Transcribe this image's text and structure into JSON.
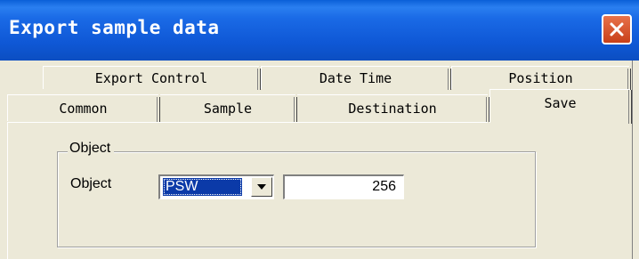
{
  "window": {
    "title": "Export sample data"
  },
  "tabs": {
    "row1": [
      {
        "label": "Export Control"
      },
      {
        "label": "Date Time"
      },
      {
        "label": "Position"
      }
    ],
    "row2": [
      {
        "label": "Common"
      },
      {
        "label": "Sample"
      },
      {
        "label": "Destination"
      },
      {
        "label": "Save",
        "selected": true
      }
    ]
  },
  "object_group": {
    "legend": "Object",
    "field_label": "Object",
    "selected_option": "PSW",
    "value": "256"
  },
  "icons": {
    "close": "close-x-icon",
    "dropdown": "chevron-down-icon"
  },
  "colors": {
    "titlebar": "#0f58d6",
    "close_button": "#d85a2e",
    "selection": "#0b3aa8",
    "panel": "#ece9d8"
  }
}
